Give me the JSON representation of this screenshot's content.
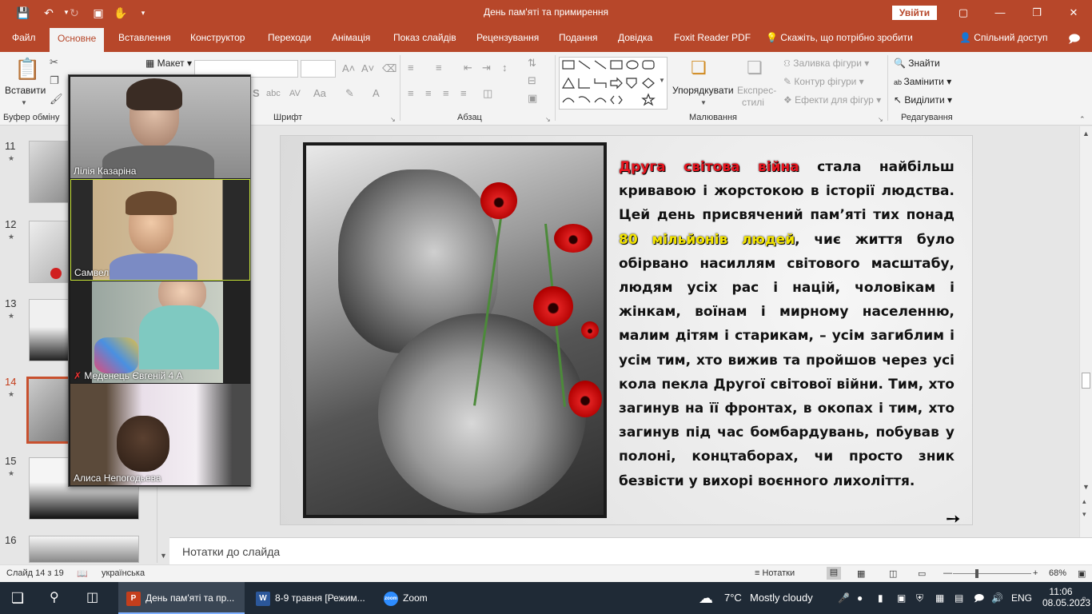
{
  "window": {
    "title": "День пам'яті та примирення",
    "sign_in": "Увійти"
  },
  "menu_tabs": [
    "Файл",
    "Основне",
    "Вставлення",
    "Конструктор",
    "Переходи",
    "Анімація",
    "Показ слайдів",
    "Рецензування",
    "Подання",
    "Довідка",
    "Foxit Reader PDF"
  ],
  "tell_me": "Скажіть, що потрібно зробити",
  "share": "Спільний доступ",
  "ribbon": {
    "paste": "Вставити",
    "layout": "Макет",
    "groups": {
      "clipboard": "Буфер обміну",
      "font": "Шрифт",
      "paragraph": "Абзац",
      "drawing": "Малювання",
      "editing": "Редагування"
    },
    "arrange": "Упорядкувати",
    "quick_styles_line1": "Експрес-",
    "quick_styles_line2": "стилі",
    "shape_fill": "Заливка фігури",
    "shape_outline": "Контур фігури",
    "shape_effects": "Ефекти для фігур",
    "find": "Знайти",
    "replace": "Замінити",
    "select": "Виділити"
  },
  "thumbnails": [
    {
      "num": "11",
      "current": false
    },
    {
      "num": "12",
      "current": false
    },
    {
      "num": "13",
      "current": false
    },
    {
      "num": "14",
      "current": true
    },
    {
      "num": "15",
      "current": false
    },
    {
      "num": "16",
      "current": false
    }
  ],
  "slide": {
    "text_runs": [
      {
        "t": "Друга світова війна",
        "style": "red"
      },
      {
        "t": " стала найбільш кривавою і жорстокою в історії людства. Цей день присвячений пам’яті тих понад ",
        "style": "normal"
      },
      {
        "t": "80 мільйонів людей",
        "style": "yel"
      },
      {
        "t": ", чиє життя було обірвано насиллям світового масштабу, людям усіх рас і націй, чоловікам і жінкам, воїнам і мирному населенню, малим дітям і старикам, – усім загиблим і усім тим, хто вижив та пройшов через усі кола пекла Другої світової війни. Тим, хто загинув на її фронтах, в окопах і тим, хто загинув під час бомбардувань, побував у полоні, концтаборах, чи просто зник безвісти у вихорі воєнного лихоліття.",
        "style": "normal"
      }
    ]
  },
  "notes_placeholder": "Нотатки до слайда",
  "status": {
    "slide_count": "Слайд 14 з 19",
    "language": "українська",
    "notes_button": "Нотатки",
    "zoom": "68%"
  },
  "zoom_participants": [
    {
      "name": "Лілія Казаріна",
      "muted": false,
      "speaking": false
    },
    {
      "name": "Самвел",
      "muted": false,
      "speaking": true
    },
    {
      "name": "Меденець Євгеній 4 А",
      "muted": true,
      "speaking": false
    },
    {
      "name": "Алиса Непогодьева",
      "muted": false,
      "speaking": false
    }
  ],
  "taskbar": {
    "apps": [
      {
        "label": "День пам'яті та пр...",
        "icon": "powerpoint-icon"
      },
      {
        "label": "8-9 травня [Режим...",
        "icon": "word-icon"
      },
      {
        "label": "Zoom",
        "icon": "zoom-icon"
      }
    ],
    "weather_temp": "7°C",
    "weather_text": "Mostly cloudy",
    "language": "ENG",
    "time": "11:06",
    "date": "08.05.2023"
  },
  "colors": {
    "accent": "#b7472a",
    "taskbar": "#1f2a36",
    "slide_red": "#e8141e",
    "slide_yellow": "#f3e400"
  }
}
